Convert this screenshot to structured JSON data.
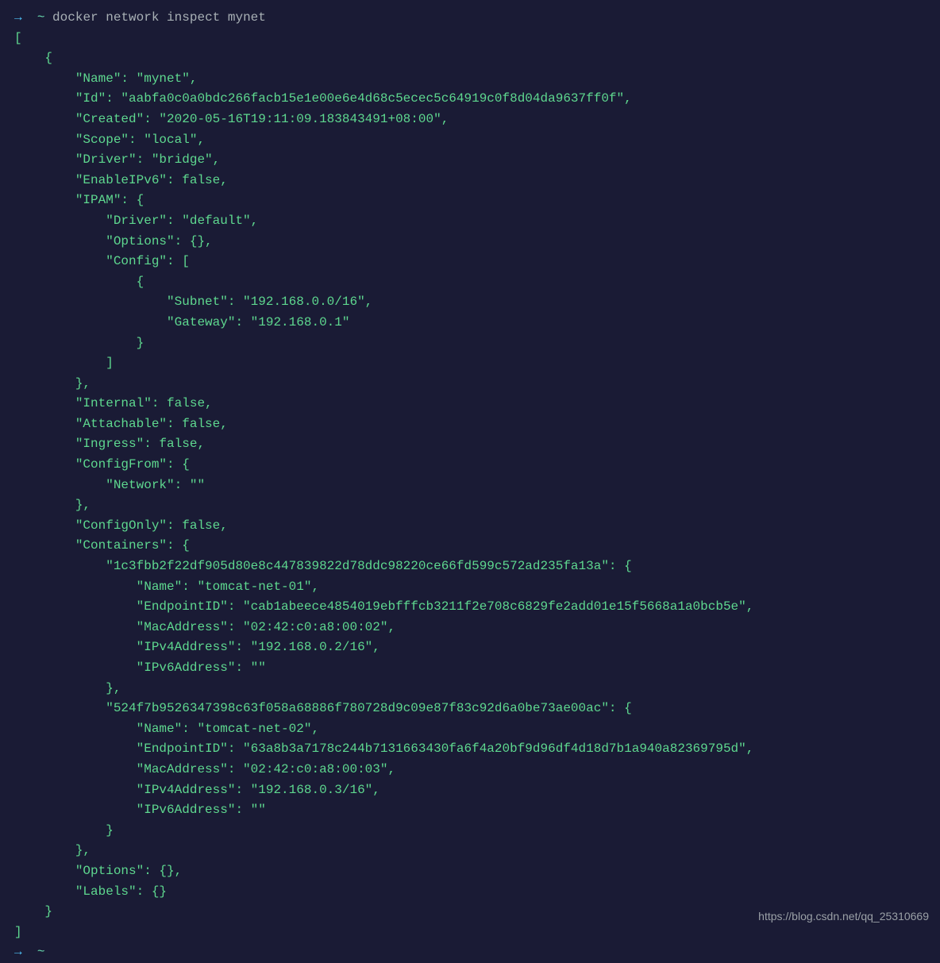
{
  "prompt": {
    "arrow": "→",
    "tilde": "~",
    "command": "docker network inspect mynet"
  },
  "output": {
    "line_open_bracket": "[",
    "line_open_brace": "    {",
    "name": "        \"Name\": \"mynet\",",
    "id": "        \"Id\": \"aabfa0c0a0bdc266facb15e1e00e6e4d68c5ecec5c64919c0f8d04da9637ff0f\",",
    "created": "        \"Created\": \"2020-05-16T19:11:09.183843491+08:00\",",
    "scope": "        \"Scope\": \"local\",",
    "driver": "        \"Driver\": \"bridge\",",
    "enableipv6": "        \"EnableIPv6\": false,",
    "ipam_open": "        \"IPAM\": {",
    "ipam_driver": "            \"Driver\": \"default\",",
    "ipam_options": "            \"Options\": {},",
    "ipam_config_open": "            \"Config\": [",
    "ipam_cfg_brace_open": "                {",
    "ipam_subnet": "                    \"Subnet\": \"192.168.0.0/16\",",
    "ipam_gateway": "                    \"Gateway\": \"192.168.0.1\"",
    "ipam_cfg_brace_close": "                }",
    "ipam_config_close": "            ]",
    "ipam_close": "        },",
    "internal": "        \"Internal\": false,",
    "attachable": "        \"Attachable\": false,",
    "ingress": "        \"Ingress\": false,",
    "configfrom_open": "        \"ConfigFrom\": {",
    "configfrom_network": "            \"Network\": \"\"",
    "configfrom_close": "        },",
    "configonly": "        \"ConfigOnly\": false,",
    "containers_open": "        \"Containers\": {",
    "c1_key": "            \"1c3fbb2f22df905d80e8c447839822d78ddc98220ce66fd599c572ad235fa13a\": {",
    "c1_name": "                \"Name\": \"tomcat-net-01\",",
    "c1_endpoint": "                \"EndpointID\": \"cab1abeece4854019ebfffcb3211f2e708c6829fe2add01e15f5668a1a0bcb5e\",",
    "c1_mac": "                \"MacAddress\": \"02:42:c0:a8:00:02\",",
    "c1_ipv4": "                \"IPv4Address\": \"192.168.0.2/16\",",
    "c1_ipv6": "                \"IPv6Address\": \"\"",
    "c1_close": "            },",
    "c2_key": "            \"524f7b9526347398c63f058a68886f780728d9c09e87f83c92d6a0be73ae00ac\": {",
    "c2_name": "                \"Name\": \"tomcat-net-02\",",
    "c2_endpoint": "                \"EndpointID\": \"63a8b3a7178c244b7131663430fa6f4a20bf9d96df4d18d7b1a940a82369795d\",",
    "c2_mac": "                \"MacAddress\": \"02:42:c0:a8:00:03\",",
    "c2_ipv4": "                \"IPv4Address\": \"192.168.0.3/16\",",
    "c2_ipv6": "                \"IPv6Address\": \"\"",
    "c2_close": "            }",
    "containers_close": "        },",
    "options": "        \"Options\": {},",
    "labels": "        \"Labels\": {}",
    "line_close_brace": "    }",
    "line_close_bracket": "]"
  },
  "prompt2": {
    "arrow": "→",
    "tilde": "~"
  },
  "watermark": "https://blog.csdn.net/qq_25310669"
}
